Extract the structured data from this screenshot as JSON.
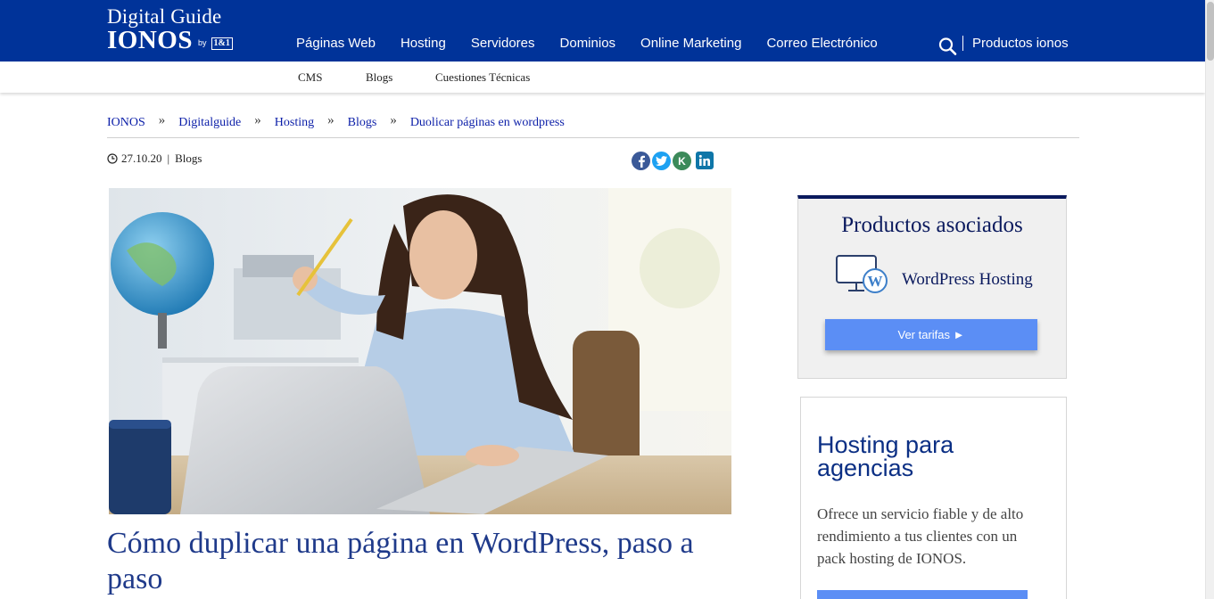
{
  "header": {
    "brand_line1": "Digital Guide",
    "brand_line2": "IONOS",
    "brand_by": "by",
    "brand_oneandone": "1&1",
    "nav": [
      "Páginas Web",
      "Hosting",
      "Servidores",
      "Dominios",
      "Online Marketing",
      "Correo Electrónico"
    ],
    "search_icon": "search-icon",
    "productos": "Productos ionos",
    "bg_color": "#003399"
  },
  "subnav": [
    "CMS",
    "Blogs",
    "Cuestiones Técnicas"
  ],
  "breadcrumb": [
    "IONOS",
    "Digitalguide",
    "Hosting",
    "Blogs",
    "Duolicar páginas en wordpress"
  ],
  "meta": {
    "date": "27.10.20",
    "separator": "|",
    "category": "Blogs"
  },
  "share": {
    "icons": [
      "facebook-icon",
      "twitter-icon",
      "kununu-icon",
      "linkedin-icon"
    ],
    "kununu_letter": "K"
  },
  "article": {
    "title": "Cómo duplicar una página en WordPress, paso a paso"
  },
  "sidebar": {
    "card1": {
      "title": "Productos asociados",
      "product": "WordPress Hosting",
      "button": "Ver tarifas ►"
    },
    "card2": {
      "title": "Hosting para agencias",
      "text": "Ofrece un servicio fiable y de alto rendimiento a tus clientes con un pack hosting de IONOS."
    }
  },
  "colors": {
    "primary": "#003399",
    "link": "#0b1ea8",
    "button": "#5b8ef5",
    "title": "#1f3a8a"
  }
}
